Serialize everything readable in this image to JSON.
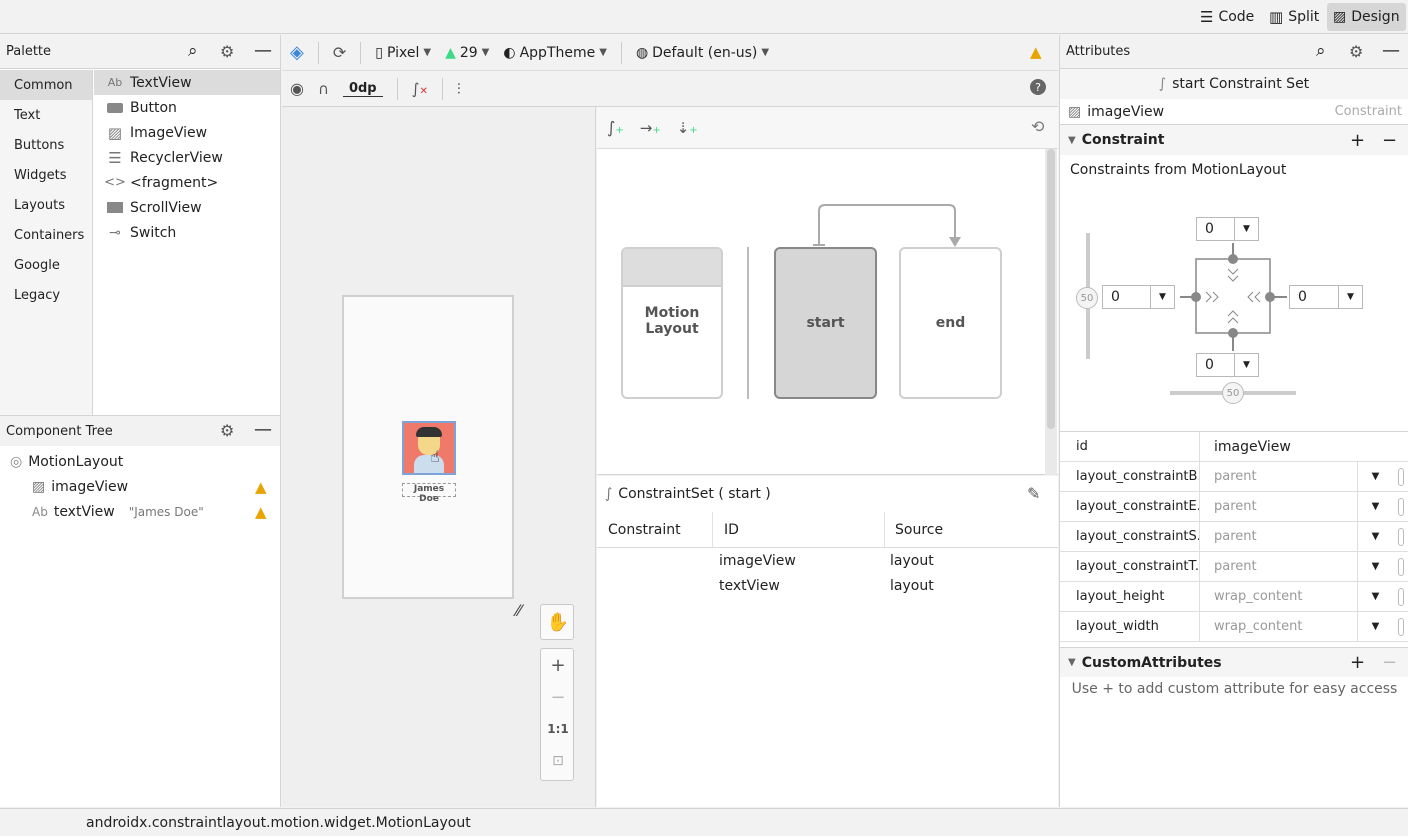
{
  "topbar": {
    "modes": [
      {
        "label": "Code",
        "icon": "code-lines-icon"
      },
      {
        "label": "Split",
        "icon": "split-icon"
      },
      {
        "label": "Design",
        "icon": "image-icon",
        "active": true
      }
    ]
  },
  "palette": {
    "title": "Palette",
    "categories": [
      "Common",
      "Text",
      "Buttons",
      "Widgets",
      "Layouts",
      "Containers",
      "Google",
      "Legacy"
    ],
    "selected_category": "Common",
    "items": [
      {
        "label": "TextView",
        "icon": "Ab"
      },
      {
        "label": "Button",
        "icon": "button-icon"
      },
      {
        "label": "ImageView",
        "icon": "image-icon"
      },
      {
        "label": "RecyclerView",
        "icon": "list-icon"
      },
      {
        "label": "<fragment>",
        "icon": "code-brackets-icon"
      },
      {
        "label": "ScrollView",
        "icon": "scroll-icon"
      },
      {
        "label": "Switch",
        "icon": "switch-icon"
      }
    ]
  },
  "component_tree": {
    "title": "Component Tree",
    "root": "MotionLayout",
    "children": [
      {
        "icon": "image-icon",
        "label": "imageView",
        "hint": ""
      },
      {
        "icon": "Ab",
        "label": "textView",
        "hint": "\"James Doe\""
      }
    ]
  },
  "design_toolbar": {
    "device": "Pixel",
    "api": "29",
    "theme": "AppTheme",
    "locale": "Default (en-us)",
    "margin": "0dp"
  },
  "canvas": {
    "preview_text": "James Doe"
  },
  "motion": {
    "motion_layout_label": "Motion\nLayout",
    "start_label": "start",
    "end_label": "end",
    "constraint_set_title": "ConstraintSet ( start )",
    "table_headers": [
      "Constraint",
      "ID",
      "Source"
    ],
    "table_rows": [
      {
        "constraint": "",
        "id": "imageView",
        "source": "layout"
      },
      {
        "constraint": "",
        "id": "textView",
        "source": "layout"
      }
    ]
  },
  "attributes": {
    "title": "Attributes",
    "constraint_set": "start Constraint Set",
    "component": "imageView",
    "component_type": "Constraint",
    "constraint_section": "Constraint",
    "constraints_from": "Constraints from MotionLayout",
    "margins": {
      "top": "0",
      "left": "0",
      "right": "0",
      "bottom": "0"
    },
    "bias_h": "50",
    "bias_v": "50",
    "id_key": "id",
    "id_value": "imageView",
    "rows": [
      {
        "key": "layout_constraintB...",
        "value": "parent"
      },
      {
        "key": "layout_constraintE...",
        "value": "parent"
      },
      {
        "key": "layout_constraintS...",
        "value": "parent"
      },
      {
        "key": "layout_constraintT...",
        "value": "parent"
      },
      {
        "key": "layout_height",
        "value": "wrap_content"
      },
      {
        "key": "layout_width",
        "value": "wrap_content"
      }
    ],
    "custom_section": "CustomAttributes",
    "custom_hint": "Use + to add custom attribute for easy access"
  },
  "zoom": {
    "fit_label": "1:1"
  },
  "status_bar": {
    "text": "androidx.constraintlayout.motion.widget.MotionLayout"
  },
  "colors": {
    "warning": "#e8a400",
    "android_green": "#3ddc84",
    "avatar_bg": "#f07a6a"
  }
}
